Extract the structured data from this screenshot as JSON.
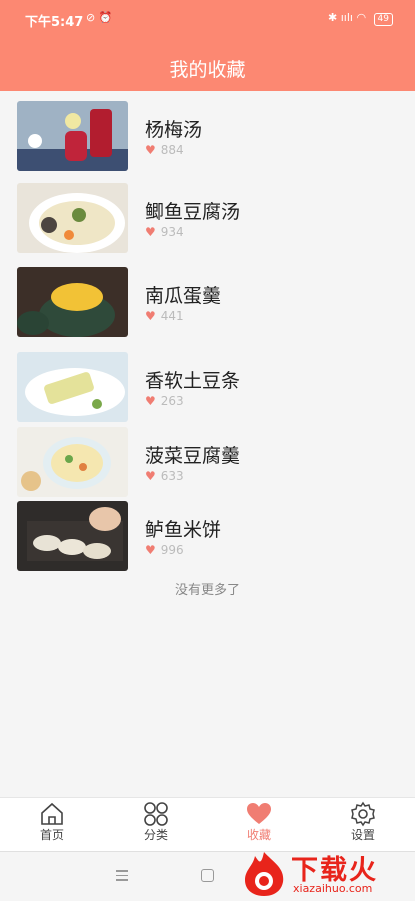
{
  "status": {
    "time": "下午5:47",
    "battery": "49",
    "signal": "ıılı"
  },
  "header": {
    "title": "我的收藏"
  },
  "items": [
    {
      "name": "杨梅汤",
      "likes": "884"
    },
    {
      "name": "鲫鱼豆腐汤",
      "likes": "934"
    },
    {
      "name": "南瓜蛋羹",
      "likes": "441"
    },
    {
      "name": "香软土豆条",
      "likes": "263"
    },
    {
      "name": "菠菜豆腐羹",
      "likes": "633"
    },
    {
      "name": "鲈鱼米饼",
      "likes": "996"
    }
  ],
  "footer_text": "没有更多了",
  "tabs": [
    {
      "label": "首页"
    },
    {
      "label": "分类"
    },
    {
      "label": "收藏"
    },
    {
      "label": "设置"
    }
  ],
  "watermark": {
    "text": "下载火",
    "url": "xiazaihuo.com"
  },
  "colors": {
    "accent": "#fc8872",
    "heart": "#f07d72"
  }
}
